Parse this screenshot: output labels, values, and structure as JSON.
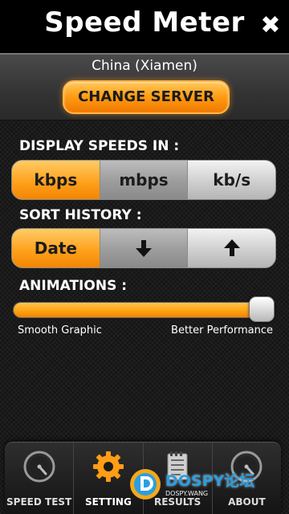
{
  "header": {
    "title": "Speed Meter",
    "close_glyph": "✖"
  },
  "server": {
    "name": "China (Xiamen)",
    "change_label": "CHANGE SERVER"
  },
  "display_speeds": {
    "label": "DISPLAY SPEEDS IN :",
    "options": [
      "kbps",
      "mbps",
      "kb/s"
    ],
    "selected": "kbps"
  },
  "sort_history": {
    "label": "SORT HISTORY :",
    "options": [
      "Date",
      "arrow-down-icon",
      "arrow-up-icon"
    ],
    "date_label": "Date",
    "selected": "Date"
  },
  "animations": {
    "label": "ANIMATIONS :",
    "left_caption": "Smooth Graphic",
    "right_caption": "Better Performance",
    "value": 1.0
  },
  "nav": {
    "items": [
      {
        "label": "SPEED TEST",
        "icon": "gauge-icon"
      },
      {
        "label": "SETTING",
        "icon": "gear-icon"
      },
      {
        "label": "RESULTS",
        "icon": "notepad-icon"
      },
      {
        "label": "ABOUT",
        "icon": "gauge-icon"
      }
    ],
    "active": "SETTING"
  },
  "watermark": {
    "text": "DOSPY论坛",
    "sub": "DOSPY.WANG"
  },
  "colors": {
    "accent": "#ffa214",
    "background": "#1a1a1a",
    "watermark": "#2a9fe0"
  }
}
